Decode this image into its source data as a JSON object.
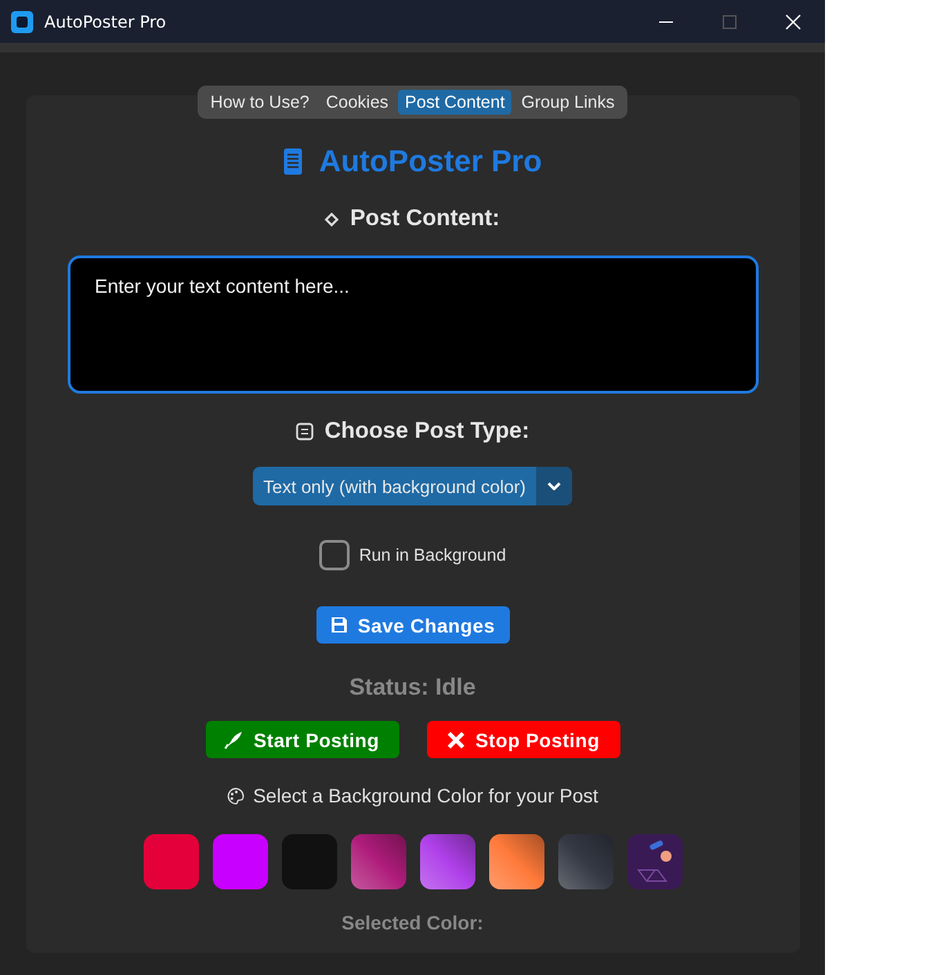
{
  "window": {
    "title": "AutoPoster Pro"
  },
  "tabs": [
    {
      "label": "How to Use?",
      "selected": false
    },
    {
      "label": "Cookies",
      "selected": false
    },
    {
      "label": "Post Content",
      "selected": true
    },
    {
      "label": "Group Links",
      "selected": false
    }
  ],
  "heading": "AutoPoster Pro",
  "post_content": {
    "label": "Post Content:",
    "placeholder": "Enter your text content here..."
  },
  "post_type": {
    "label": "Choose Post Type:",
    "value": "Text only (with background color)"
  },
  "run_in_background": {
    "label": "Run in Background",
    "checked": false
  },
  "save_button": "Save Changes",
  "status": "Status: Idle",
  "start_button": "Start Posting",
  "stop_button": "Stop Posting",
  "color_prompt": "Select a Background Color for your Post",
  "swatches": [
    {
      "kind": "solid",
      "color": "#e4003a"
    },
    {
      "kind": "solid",
      "color": "#c800ff"
    },
    {
      "kind": "solid",
      "color": "#111111"
    },
    {
      "kind": "gradient",
      "color": "#b01c7c"
    },
    {
      "kind": "gradient",
      "color": "#b040ea"
    },
    {
      "kind": "gradient",
      "color": "#ff7a3a"
    },
    {
      "kind": "gradient",
      "color": "#353944"
    },
    {
      "kind": "pattern",
      "color": "#3a1a55"
    }
  ],
  "selected_color_label": "Selected Color:"
}
